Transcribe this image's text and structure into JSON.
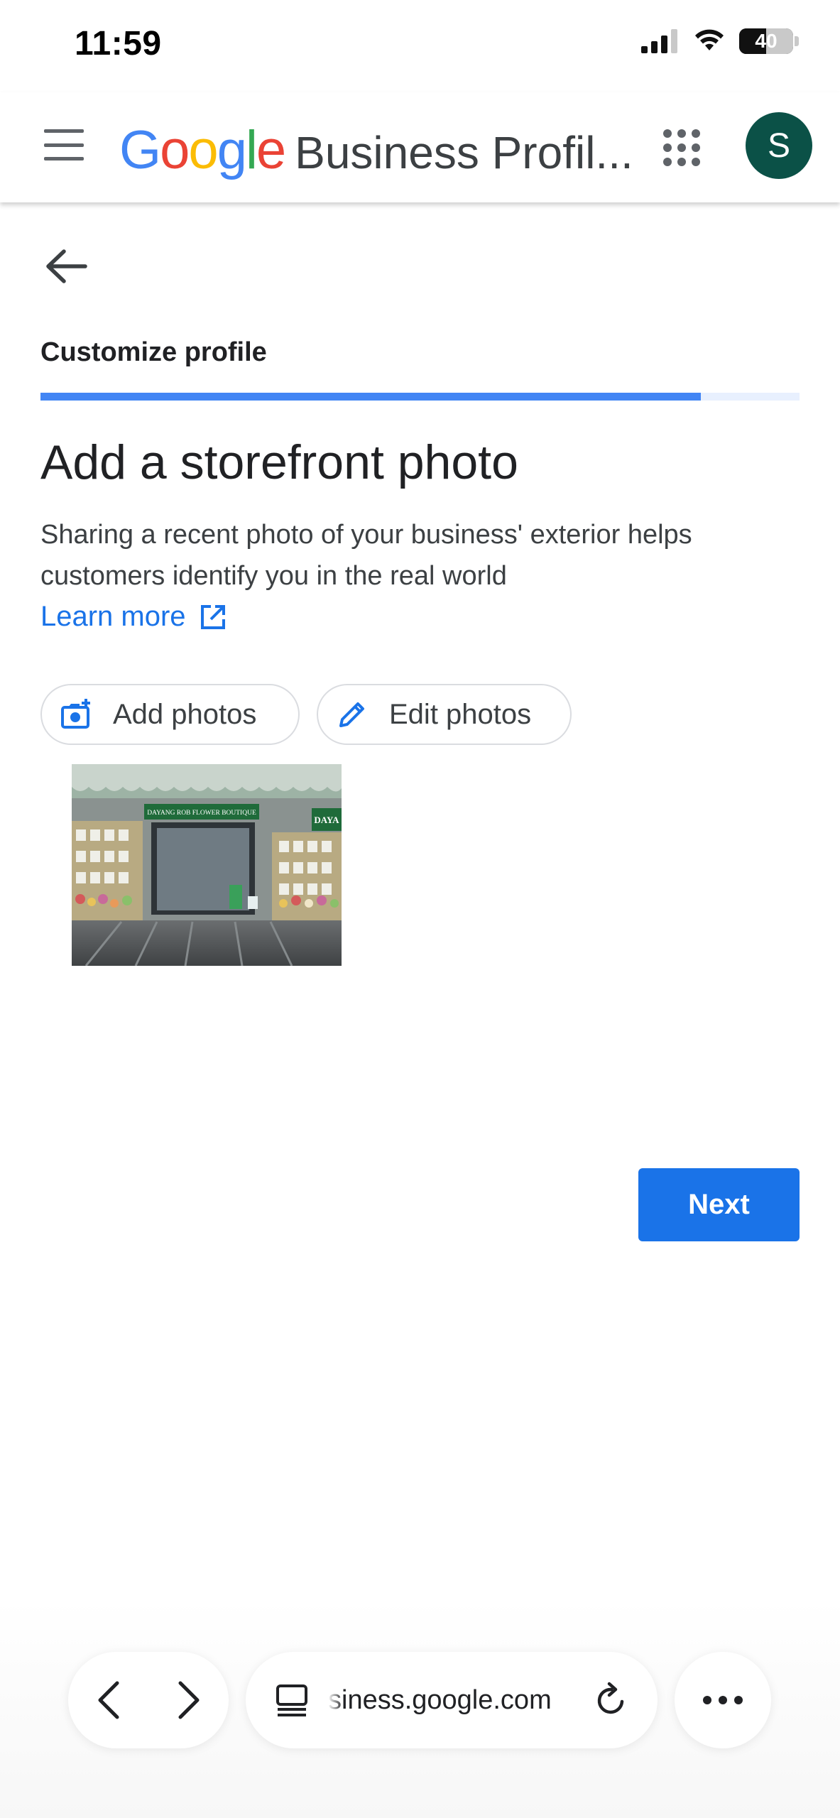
{
  "status_bar": {
    "time": "11:59",
    "battery": "40"
  },
  "header": {
    "logo_letters": [
      {
        "char": "G",
        "color": "#4285F4"
      },
      {
        "char": "o",
        "color": "#EA4335"
      },
      {
        "char": "o",
        "color": "#FBBC05"
      },
      {
        "char": "g",
        "color": "#4285F4"
      },
      {
        "char": "l",
        "color": "#34A853"
      },
      {
        "char": "e",
        "color": "#EA4335"
      }
    ],
    "product_name": "Business Profil...",
    "avatar_initial": "S",
    "avatar_color": "#0B5147"
  },
  "step": {
    "label": "Customize profile",
    "progress": 0.87
  },
  "main": {
    "title": "Add a storefront photo",
    "description": "Sharing a recent photo of your business' exterior helps customers identify you in the real world",
    "learn_more": "Learn more",
    "add_photos_label": "Add photos",
    "edit_photos_label": "Edit photos",
    "photo_sign_text": "DAYANG ROB FLOWER BOUTIQUE",
    "photo_side_sign_text": "DAYA",
    "next_label": "Next"
  },
  "browser": {
    "url": "siness.google.com"
  },
  "colors": {
    "accent": "#1A73E8",
    "progress": "#4285F4",
    "progress_track": "#E8F0FE"
  },
  "icons": {
    "menu": "menu-icon",
    "apps": "apps-grid-icon",
    "back": "back-arrow-icon",
    "external": "open-in-new-icon",
    "add_photo": "add-photo-icon",
    "edit": "pencil-icon",
    "nav_back": "chevron-left-icon",
    "nav_forward": "chevron-right-icon",
    "tabs": "tab-overview-icon",
    "reload": "reload-icon",
    "more": "more-horizontal-icon"
  }
}
